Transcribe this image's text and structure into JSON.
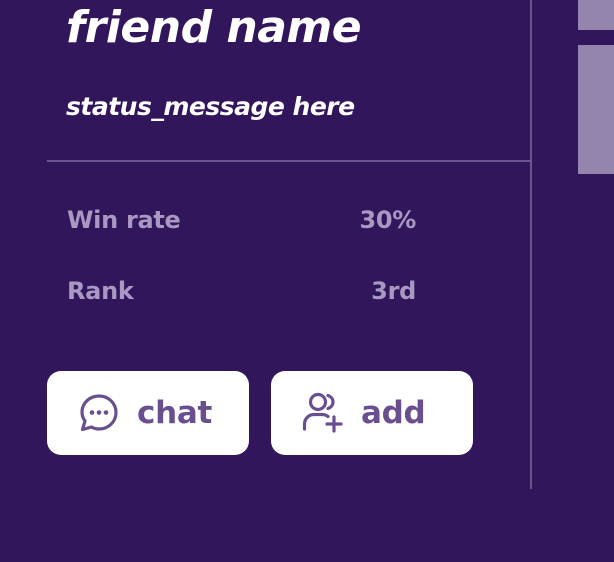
{
  "profile": {
    "friend_name": "friend name",
    "status_message": "status_message here"
  },
  "stats": {
    "win_rate_label": "Win rate",
    "win_rate_value": "30%",
    "rank_label": "Rank",
    "rank_value": "3rd"
  },
  "actions": {
    "chat_label": "chat",
    "chat_icon": "chat-bubble-icon",
    "add_label": "add",
    "add_icon": "add-user-icon"
  },
  "colors": {
    "background": "#32165c",
    "accent": "#6a4f8f",
    "muted_text": "#a898c2",
    "divider": "#6a558d",
    "scrollbar": "#9385ad"
  }
}
